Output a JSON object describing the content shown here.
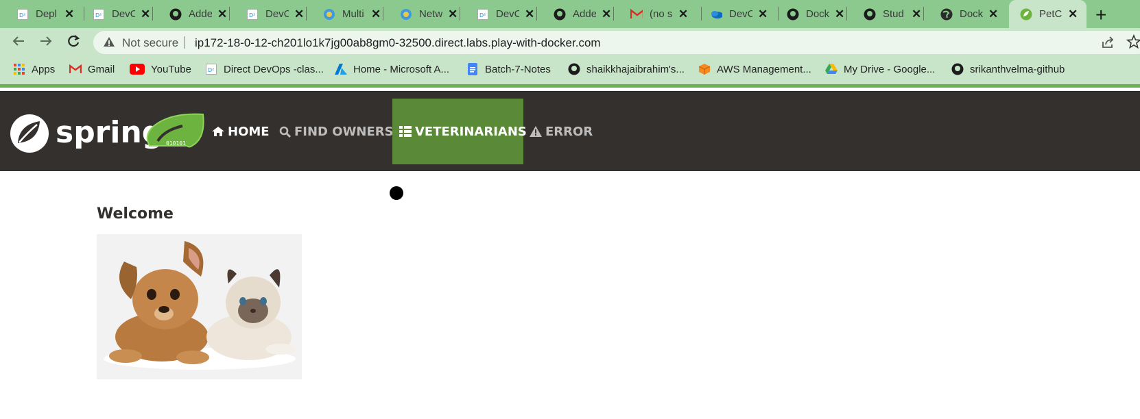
{
  "browser": {
    "tabs": [
      {
        "title": "Depl",
        "icon": "devops-doc-icon"
      },
      {
        "title": "DevC",
        "icon": "devops-doc-icon"
      },
      {
        "title": "Adde",
        "icon": "github-icon"
      },
      {
        "title": "DevC",
        "icon": "devops-doc-icon"
      },
      {
        "title": "Multi",
        "icon": "globe-icon"
      },
      {
        "title": "Netw",
        "icon": "globe-icon"
      },
      {
        "title": "DevC",
        "icon": "devops-doc-icon"
      },
      {
        "title": "Adde",
        "icon": "github-icon"
      },
      {
        "title": "(no s",
        "icon": "gmail-icon"
      },
      {
        "title": "DevC",
        "icon": "onedrive-icon"
      },
      {
        "title": "Dock",
        "icon": "github-icon"
      },
      {
        "title": "Stud",
        "icon": "github-icon"
      },
      {
        "title": "Dock",
        "icon": "world-icon"
      },
      {
        "title": "PetC",
        "icon": "spring-leaf-icon",
        "active": true
      }
    ],
    "new_tab_symbol": "+",
    "close_symbol": "✕",
    "security_label": "Not secure",
    "url": "ip172-18-0-12-ch201lo1k7jg00ab8gm0-32500.direct.labs.play-with-docker.com",
    "bookmarks": [
      {
        "label": "Apps",
        "icon": "apps-grid-icon"
      },
      {
        "label": "Gmail",
        "icon": "gmail-icon"
      },
      {
        "label": "YouTube",
        "icon": "youtube-icon"
      },
      {
        "label": "Direct DevOps -clas...",
        "icon": "devops-doc-icon"
      },
      {
        "label": "Home - Microsoft A...",
        "icon": "azure-icon"
      },
      {
        "label": "Batch-7-Notes",
        "icon": "google-docs-icon"
      },
      {
        "label": "shaikkhajaibrahim's...",
        "icon": "github-icon"
      },
      {
        "label": "AWS Management...",
        "icon": "aws-icon"
      },
      {
        "label": "My Drive - Google...",
        "icon": "google-drive-icon"
      },
      {
        "label": "srikanthvelma-github",
        "icon": "github-icon"
      }
    ],
    "colors": {
      "tabstrip": "#8bc98e",
      "toolbar": "#c8e5c9",
      "accent": "#6bb150"
    }
  },
  "app": {
    "brand": {
      "word": "spring",
      "badge_text": "010101"
    },
    "nav": [
      {
        "label": "HOME",
        "icon": "home-icon",
        "active": false
      },
      {
        "label": "FIND OWNERS",
        "icon": "search-icon",
        "active": false
      },
      {
        "label": "VETERINARIANS",
        "icon": "list-icon",
        "active": true
      },
      {
        "label": "ERROR",
        "icon": "warning-icon",
        "active": false
      }
    ],
    "colors": {
      "navbar": "#34302d",
      "active_nav": "#5a8a38",
      "nav_text": "#ffffff",
      "nav_text_muted": "#bdbdbd"
    },
    "heading": "Welcome",
    "image_description_icon": "pets-image"
  }
}
